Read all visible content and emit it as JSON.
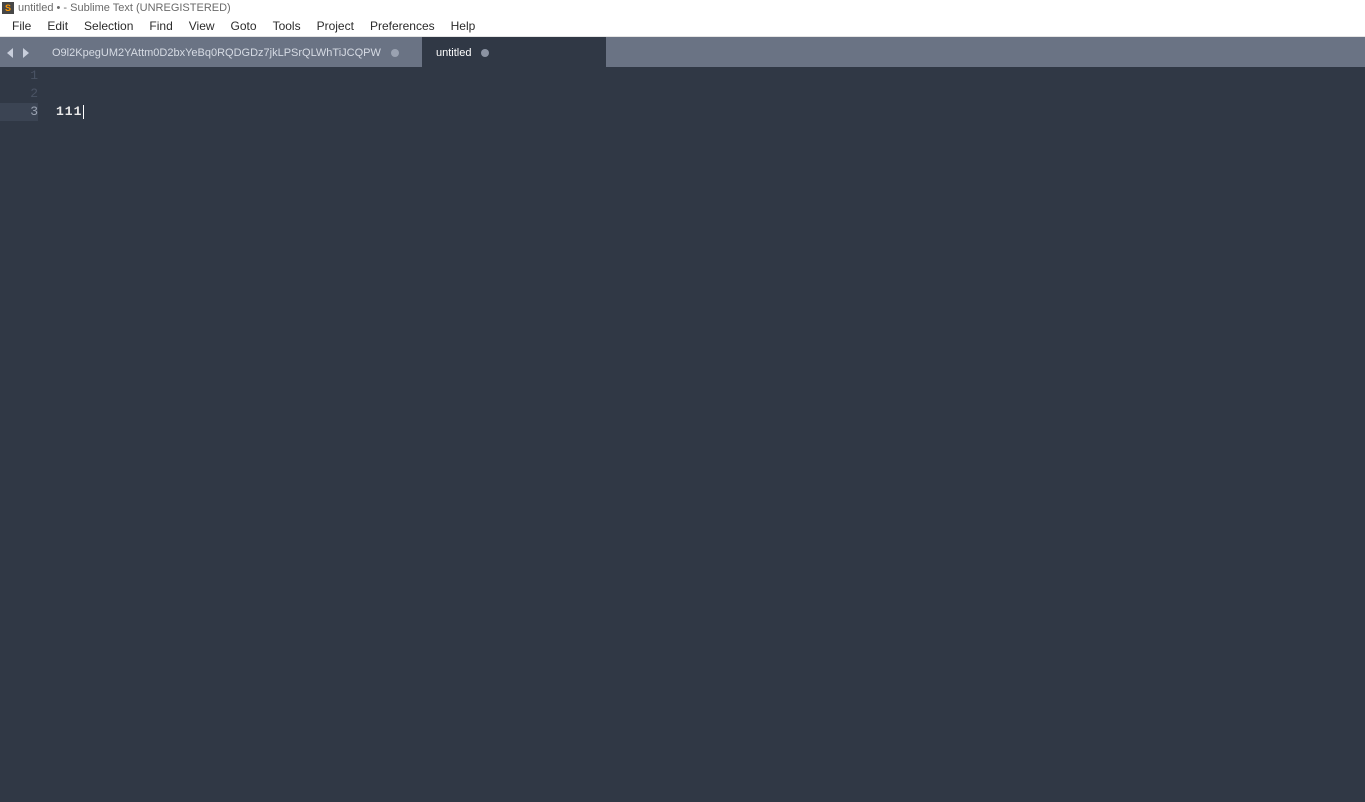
{
  "window": {
    "title": "untitled • - Sublime Text (UNREGISTERED)"
  },
  "menu": {
    "items": [
      "File",
      "Edit",
      "Selection",
      "Find",
      "View",
      "Goto",
      "Tools",
      "Project",
      "Preferences",
      "Help"
    ]
  },
  "tabs": [
    {
      "label": "O9l2KpegUM2YAttm0D2bxYeBq0RQDGDz7jkLPSrQLWhTiJCQPW",
      "active": false,
      "dirty": true
    },
    {
      "label": "untitled",
      "active": true,
      "dirty": true
    }
  ],
  "editor": {
    "lines": [
      {
        "num": 1,
        "text": ""
      },
      {
        "num": 2,
        "text": ""
      },
      {
        "num": 3,
        "text": "111",
        "current": true
      }
    ]
  }
}
